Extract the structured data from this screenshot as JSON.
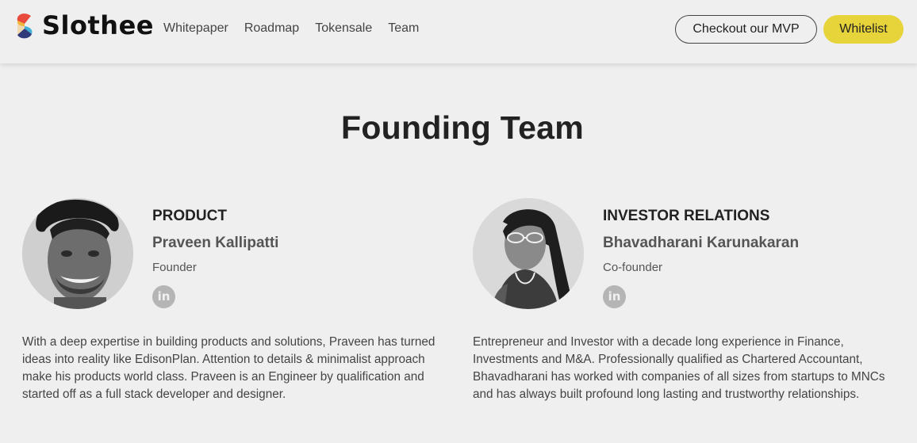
{
  "brand": {
    "name": "Slothee",
    "colors": [
      "#e84a3c",
      "#f2b53a",
      "#3fb0d6",
      "#2f3a7a"
    ]
  },
  "nav": {
    "links": [
      "Whitepaper",
      "Roadmap",
      "Tokensale",
      "Team"
    ],
    "mvp_label": "Checkout our MVP",
    "whitelist_label": "Whitelist",
    "accent": "#e6d43a"
  },
  "section": {
    "title": "Founding Team"
  },
  "members": [
    {
      "role": "PRODUCT",
      "name": "Praveen Kallipatti",
      "title": "Founder",
      "social_icon": "linkedin-icon",
      "bio": "With a deep expertise in building products and solutions, Praveen has turned ideas into reality like EdisonPlan. Attention to details & minimalist approach make his products world class. Praveen is an Engineer by qualification and started off as a full stack developer and designer."
    },
    {
      "role": "INVESTOR RELATIONS",
      "name": "Bhavadharani Karunakaran",
      "title": "Co-founder",
      "social_icon": "linkedin-icon",
      "bio": "Entrepreneur and Investor with a decade long experience in Finance, Investments and M&A. Professionally qualified as Chartered Accountant, Bhavadharani has worked with companies of all sizes from startups to MNCs and has always built profound long lasting and trustworthy relationships."
    }
  ]
}
